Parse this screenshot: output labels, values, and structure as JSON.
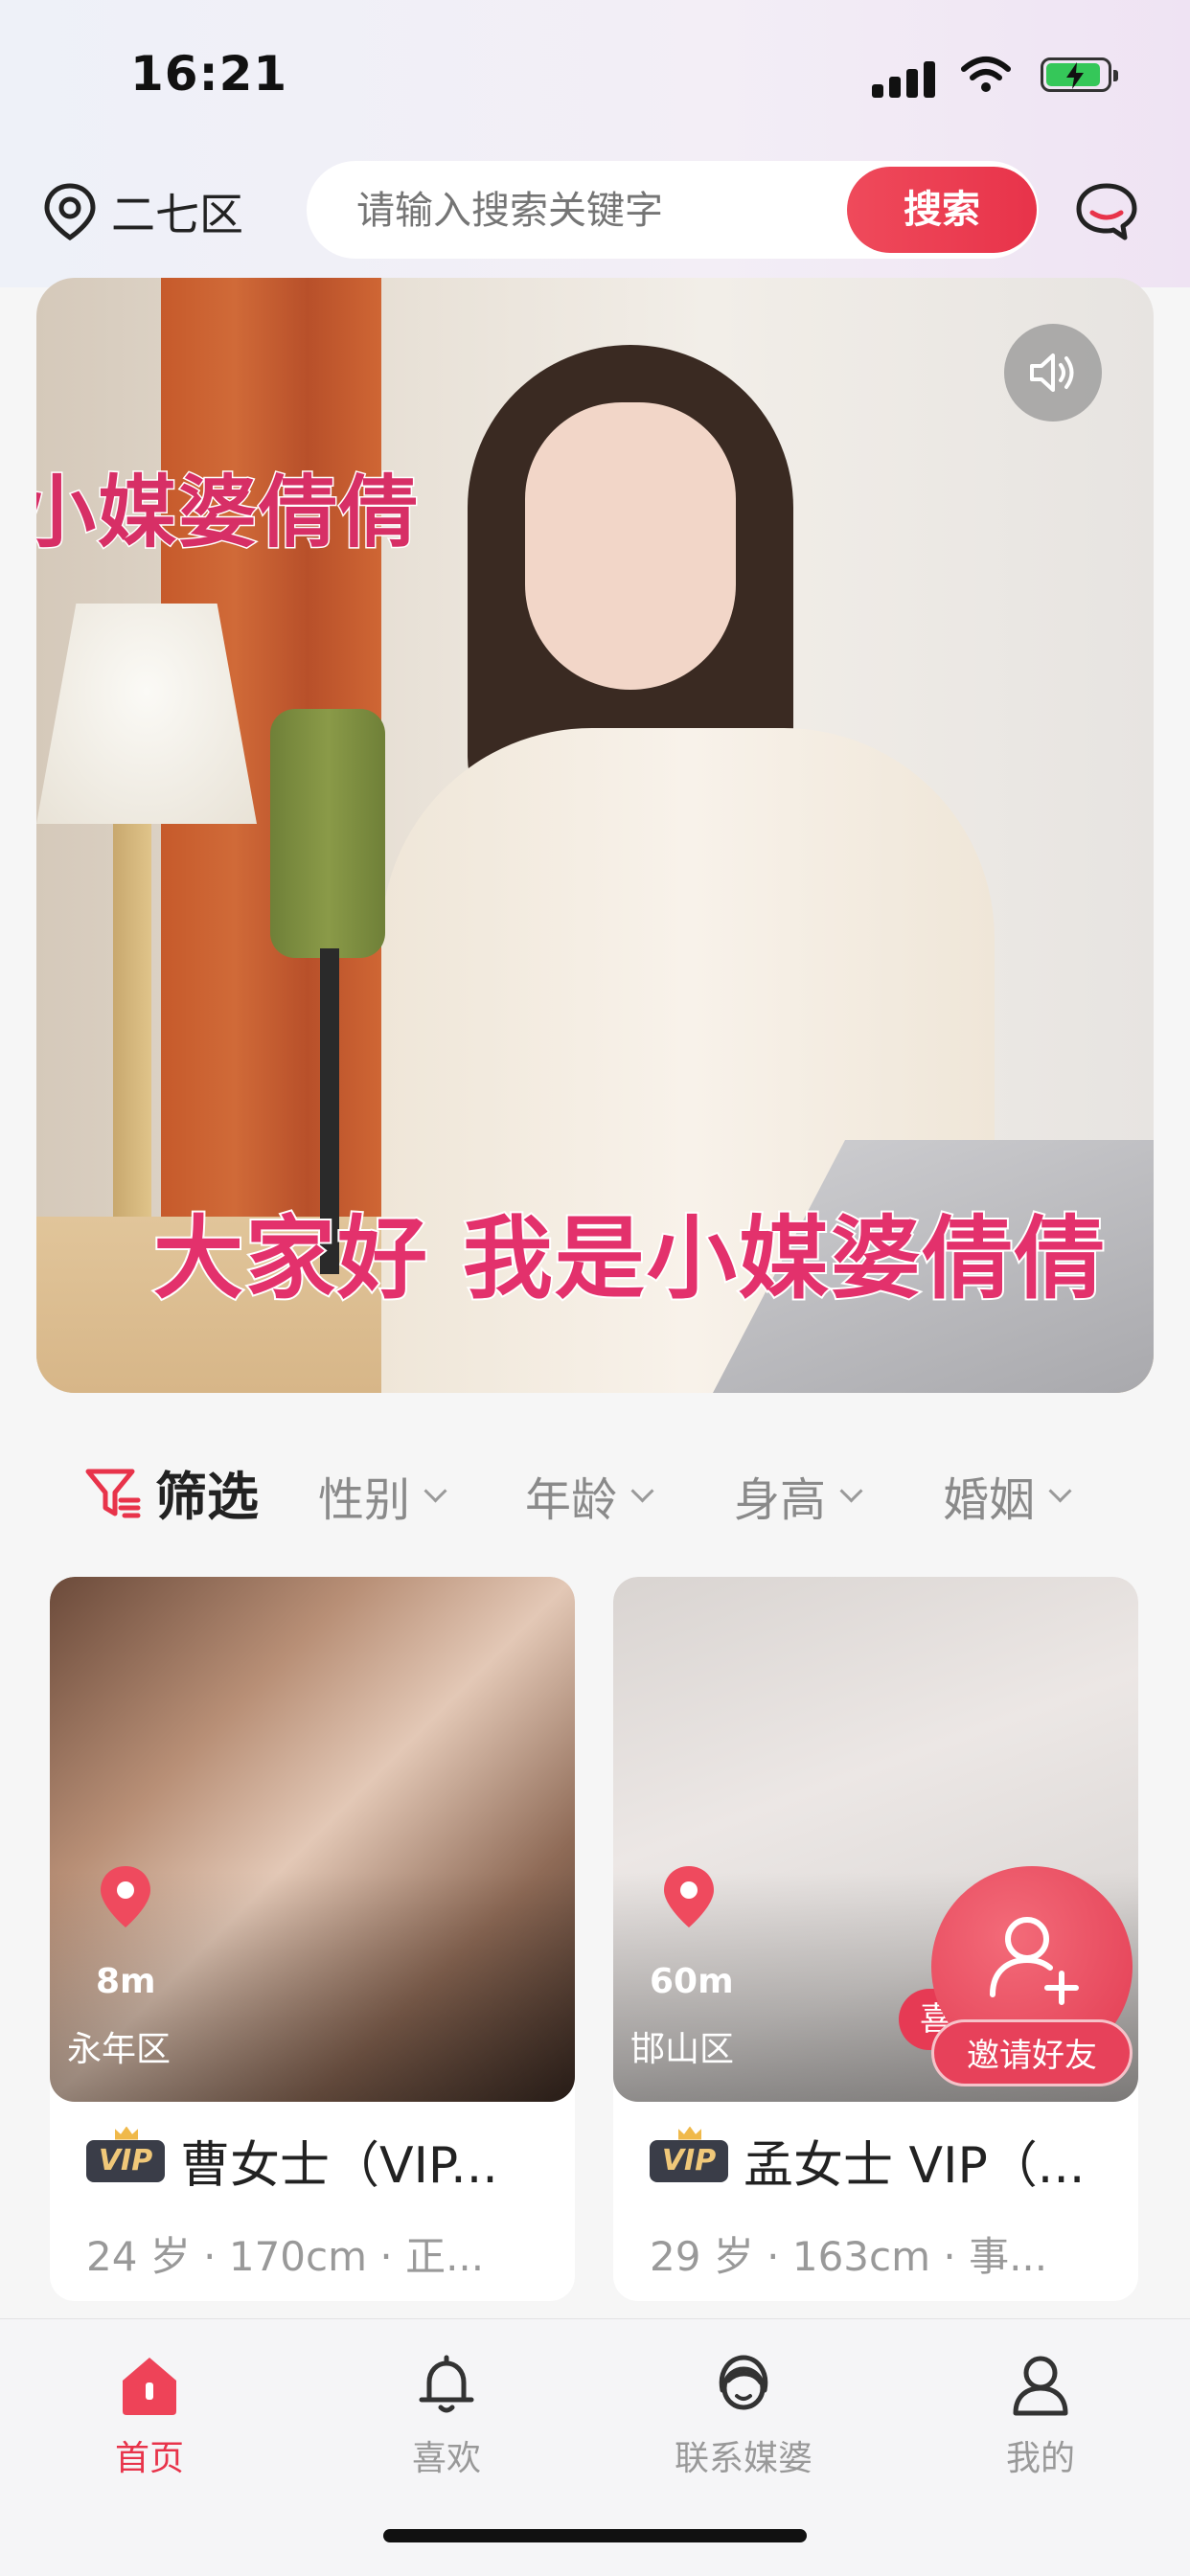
{
  "status_bar": {
    "time": "16:21"
  },
  "header": {
    "location": "二七区",
    "search_placeholder": "请输入搜索关键字",
    "search_button": "搜索"
  },
  "video": {
    "caption_top": "小媒婆倩倩",
    "caption_bottom": "大家好 我是小媒婆倩倩"
  },
  "filters": {
    "main_label": "筛选",
    "options": [
      "性别",
      "年龄",
      "身高",
      "婚姻"
    ]
  },
  "cards": [
    {
      "distance": "8m",
      "area": "永年区",
      "vip": "VIP",
      "name": "曹女士（VIP...",
      "info": "24 岁 · 170cm · 正..."
    },
    {
      "distance": "60m",
      "area": "邯山区",
      "vip": "VIP",
      "name": "孟女士 VIP（...",
      "info": "29 岁 · 163cm · 事...",
      "like_label": "喜"
    }
  ],
  "invite": {
    "label": "邀请好友"
  },
  "tabbar": {
    "items": [
      {
        "label": "首页",
        "icon": "home-icon",
        "active": true
      },
      {
        "label": "喜欢",
        "icon": "bell-icon",
        "active": false
      },
      {
        "label": "联系媒婆",
        "icon": "matchmaker-icon",
        "active": false
      },
      {
        "label": "我的",
        "icon": "person-icon",
        "active": false
      }
    ]
  },
  "colors": {
    "accent": "#e8334a",
    "tab_inactive": "#999999",
    "vip_gold": "#f0c879"
  }
}
